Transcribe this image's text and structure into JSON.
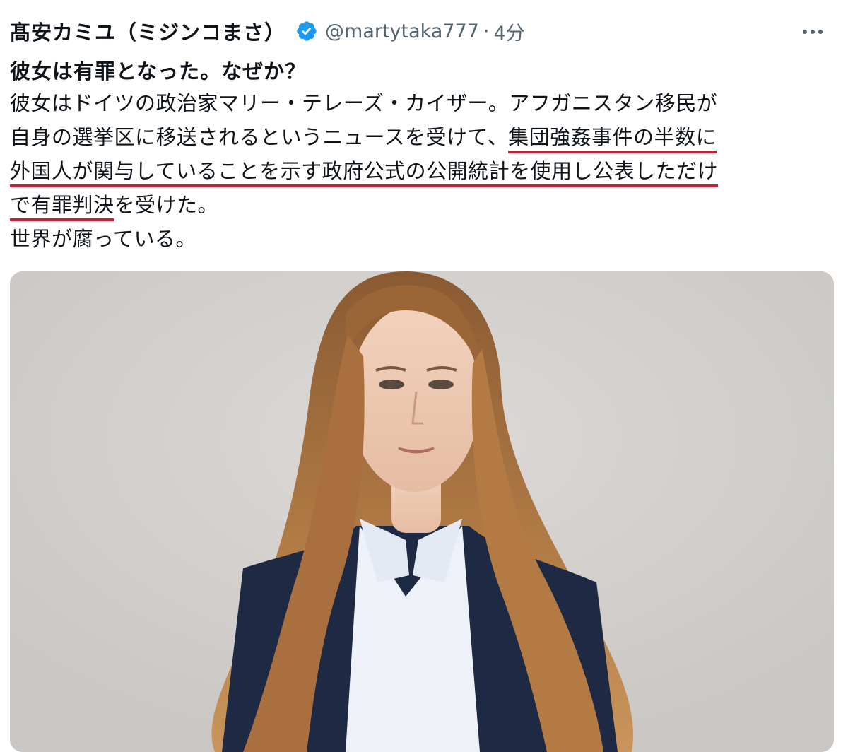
{
  "tweet": {
    "display_name": "髙安カミユ（ミジンコまさ）",
    "handle": "@martytaka777",
    "separator": "·",
    "time": "4分",
    "title": "彼女は有罪となった。なぜか？",
    "body": {
      "line1": "彼女はドイツの政治家マリー・テレーズ・カイザー。アフガニスタン移民が",
      "line2a": "自身の選挙区に移送されるというニュースを受けて、",
      "line2b": "集団強姦事件の半数に",
      "line3": "外国人が関与していることを示す政府公式の公開統計を使用し公表しただけ",
      "line4a": "で有罪判決",
      "line4b": "を受けた。",
      "line5": "世界が腐っている。"
    }
  },
  "colors": {
    "verified_badge": "#1d9bf0",
    "underline": "#c4213a",
    "secondary_text": "#536471"
  },
  "icons": {
    "verified": "verified-badge-icon",
    "more": "more-horizontal-icon"
  }
}
